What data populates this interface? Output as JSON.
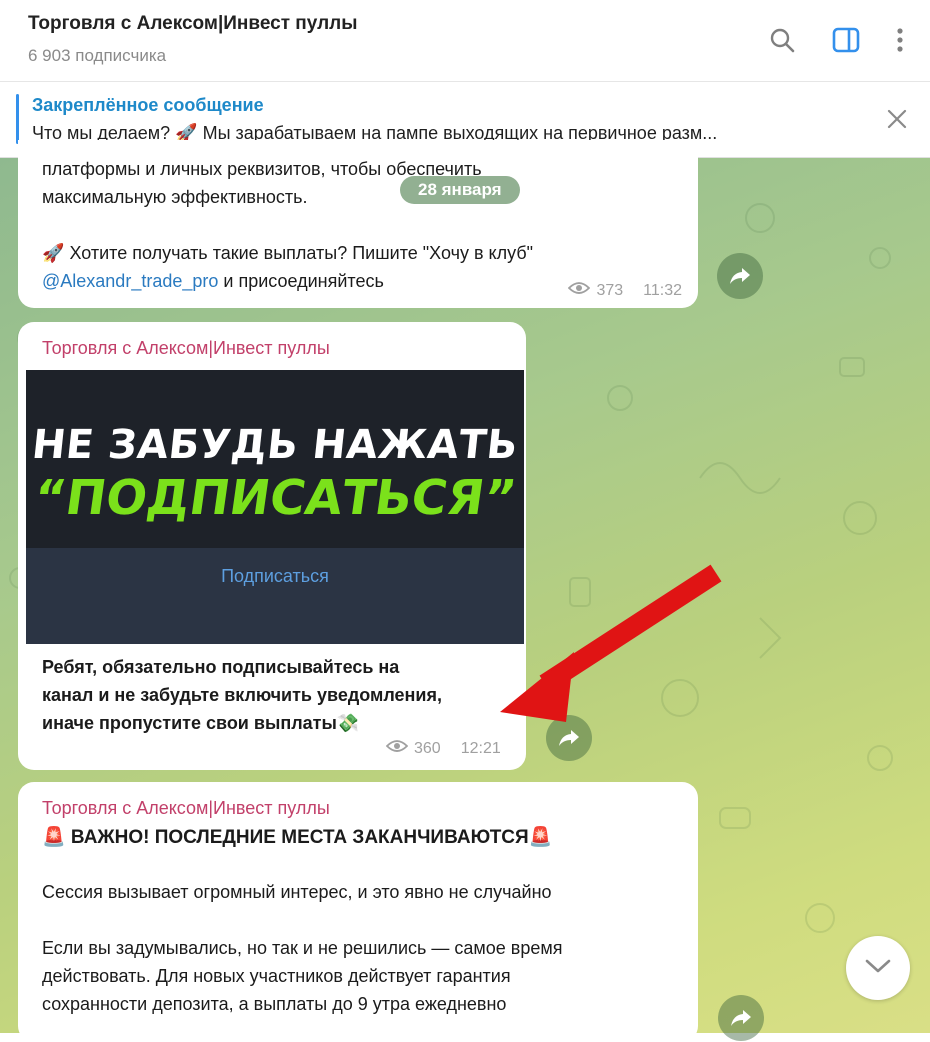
{
  "header": {
    "title": "Торговля с Алексом|Инвест пуллы",
    "subscribers": "6 903 подписчика"
  },
  "pinned": {
    "label": "Закреплённое сообщение",
    "text": "Что мы делаем? 🚀  Мы зарабатываем на пампе выходящих на первичное разм..."
  },
  "date_pill": "28 января",
  "messages": [
    {
      "lines": [
        "платформы и личных реквизитов, чтобы обеспечить",
        "максимальную эффективность."
      ],
      "cta_emoji": "🚀",
      "cta": "Хотите получать такие выплаты? Пишите \"Хочу в клуб\"",
      "link": "@Alexandr_trade_pro",
      "after_link": "и присоединяйтесь",
      "views": "373",
      "time": "11:32"
    },
    {
      "author": "Торговля с Алексом|Инвест пуллы",
      "banner_line1": "НЕ ЗАБУДЬ НАЖАТЬ",
      "banner_line2": "“ПОДПИСАТЬСЯ”",
      "banner_button": "Подписаться",
      "lines": [
        "Ребят, обязательно подписывайтесь на",
        "канал и не забудьте включить уведомления,",
        "иначе пропустите свои выплаты💸"
      ],
      "views": "360",
      "time": "12:21"
    },
    {
      "author": "Торговля с Алексом|Инвест пуллы",
      "headline": "🚨 ВАЖНО! ПОСЛЕДНИЕ МЕСТА ЗАКАНЧИВАЮТСЯ🚨",
      "p1": "Сессия вызывает огромный интерес, и это явно не случайно",
      "p2_lines": [
        "Если вы задумывались, но так и не решились — самое время",
        "действовать. Для новых участников действует гарантия",
        "сохранности депозита, а выплаты до 9 утра ежедневно"
      ]
    }
  ],
  "colors": {
    "accent": "#3390ec",
    "author": "#c2406a",
    "arrow": "#e01414"
  },
  "icons": [
    "search-icon",
    "sidebar-toggle-icon",
    "more-icon",
    "close-icon",
    "eye-icon",
    "share-icon",
    "chevron-down-icon"
  ]
}
